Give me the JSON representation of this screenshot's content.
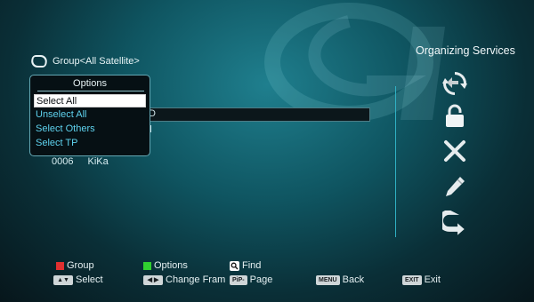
{
  "header": {
    "group_label": "Group<All Satellite>",
    "title": "Organizing Services"
  },
  "list": {
    "partial_text_1": "D",
    "partial_text_2": "nal",
    "row": {
      "number": "0006",
      "name": "KiKa"
    }
  },
  "options_popup": {
    "title": "Options",
    "items": [
      {
        "label": "Select All",
        "selected": true
      },
      {
        "label": "Unselect All",
        "selected": false
      },
      {
        "label": "Select Others",
        "selected": false
      },
      {
        "label": "Select TP",
        "selected": false
      }
    ]
  },
  "side_actions": [
    "sync-icon",
    "lock-icon",
    "delete-icon",
    "edit-icon",
    "move-icon"
  ],
  "footer": {
    "group": {
      "label": "Group",
      "color": "#e03030"
    },
    "options": {
      "label": "Options",
      "color": "#30d030"
    },
    "find": {
      "label": "Find"
    },
    "select": {
      "label": "Select"
    },
    "change_frame": {
      "label": "Change Fram"
    },
    "page": {
      "label": "Page",
      "key": "PiP-"
    },
    "back": {
      "label": "Back",
      "key": "MENU"
    },
    "exit": {
      "label": "Exit",
      "key": "EXIT"
    }
  }
}
